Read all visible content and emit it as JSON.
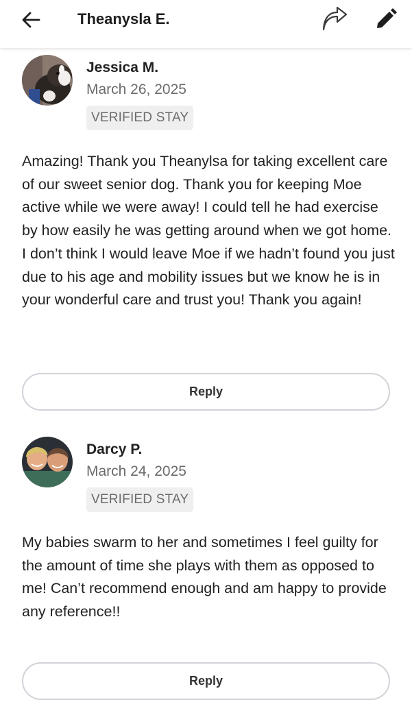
{
  "header": {
    "title": "Theanysla E.",
    "back_icon": "arrow-left-icon",
    "share_icon": "share-icon",
    "edit_icon": "pencil-icon"
  },
  "reviews": [
    {
      "name": "Jessica M.",
      "date": "March 26, 2025",
      "badge": "VERIFIED STAY",
      "text": "Amazing! Thank you Theanylsa for taking excellent care of our sweet senior dog. Thank you for keeping Moe active while we were away! I could tell he had exercise by how easily he was getting around when we got home. I don’t think I would leave Moe if we hadn’t found you just due to his age and mobility issues but we know he is in your wonderful care and trust you! Thank you again!",
      "reply_label": "Reply"
    },
    {
      "name": "Darcy P.",
      "date": "March 24, 2025",
      "badge": "VERIFIED STAY",
      "text": "My babies swarm to her and sometimes I feel guilty for the amount of time she plays with them as opposed to me! Can’t recommend enough and am happy to provide any reference!!",
      "reply_label": "Reply"
    }
  ],
  "colors": {
    "badge_bg": "#efefef",
    "muted_text": "#6b6b6b",
    "button_border": "#d0d3d8"
  }
}
